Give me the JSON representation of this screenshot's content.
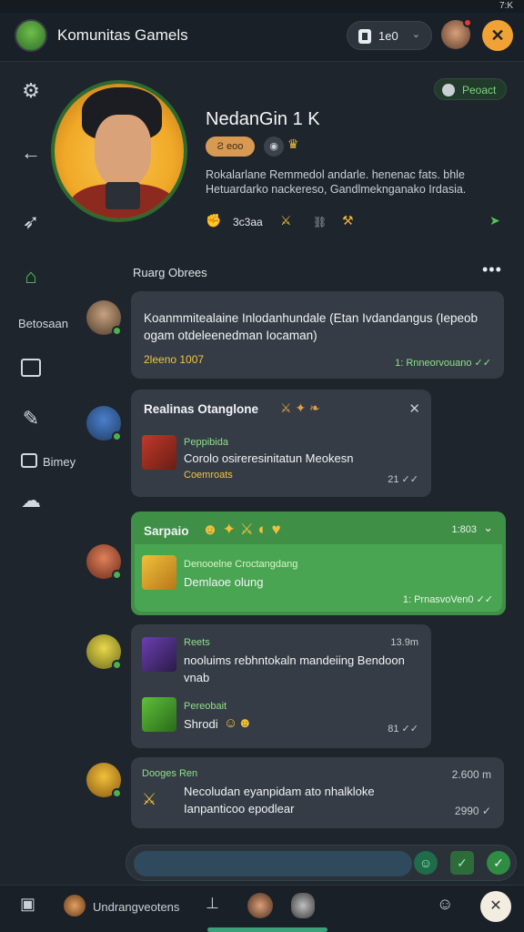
{
  "status": {
    "time": "7:K"
  },
  "header": {
    "title": "Komunitas Gamels",
    "counter": "1e0",
    "close": "✕"
  },
  "rail": {
    "label_1": "Betosaan",
    "label_2": "Bimey"
  },
  "profile": {
    "badge": "Peoact",
    "name": "NedanGin 1 K",
    "rank": "Ƨ eoo",
    "bio": "Rokalarlane Remmedol andarle. henenac fats. bhle Hetuardarko nackereso, Gandlmeknganako Irdasia.",
    "stat": "3c3aa"
  },
  "section": {
    "title": "Ruarg Obrees"
  },
  "messages": [
    {
      "text": "Koanmmitealaine Inlodanhundale (Etan Ivdandangus (Iepeob ogam otdeleenedman Iocaman)",
      "meta": "2leeno 1007",
      "time": "1: Rnneorvouano ✓✓"
    },
    {
      "title": "Realinas Otanglone",
      "sender": "Peppibida",
      "text": "Corolo osireresinitatun Meokesn",
      "meta": "Coemroats",
      "time": "21 ✓✓"
    },
    {
      "title": "Sarpaio",
      "time_top": "1:803",
      "sender": "Denooelne Croctangdang",
      "text": "Demlaoe olung",
      "time": "1: PrnasvoVen0 ✓✓"
    },
    {
      "sender": "Reets",
      "time_top": "13.9m",
      "text": "nooluims rebhntokaln mandeiing Bendoon vnab",
      "sender2": "Pereobait",
      "text2": "Shrodi",
      "time": "81 ✓✓"
    },
    {
      "sender": "Dooges Ren",
      "time_top": "2.600 m",
      "text": "Necoludan eyanpidam ato nhalkloke Ianpanticoo epodlear",
      "time": "2990 ✓"
    }
  ],
  "bottom": {
    "label": "Undrangveotens"
  },
  "colors": {
    "accent": "#3f8f47",
    "brand": "#f0a334",
    "card": "#353c45",
    "background": "#1f252c"
  }
}
